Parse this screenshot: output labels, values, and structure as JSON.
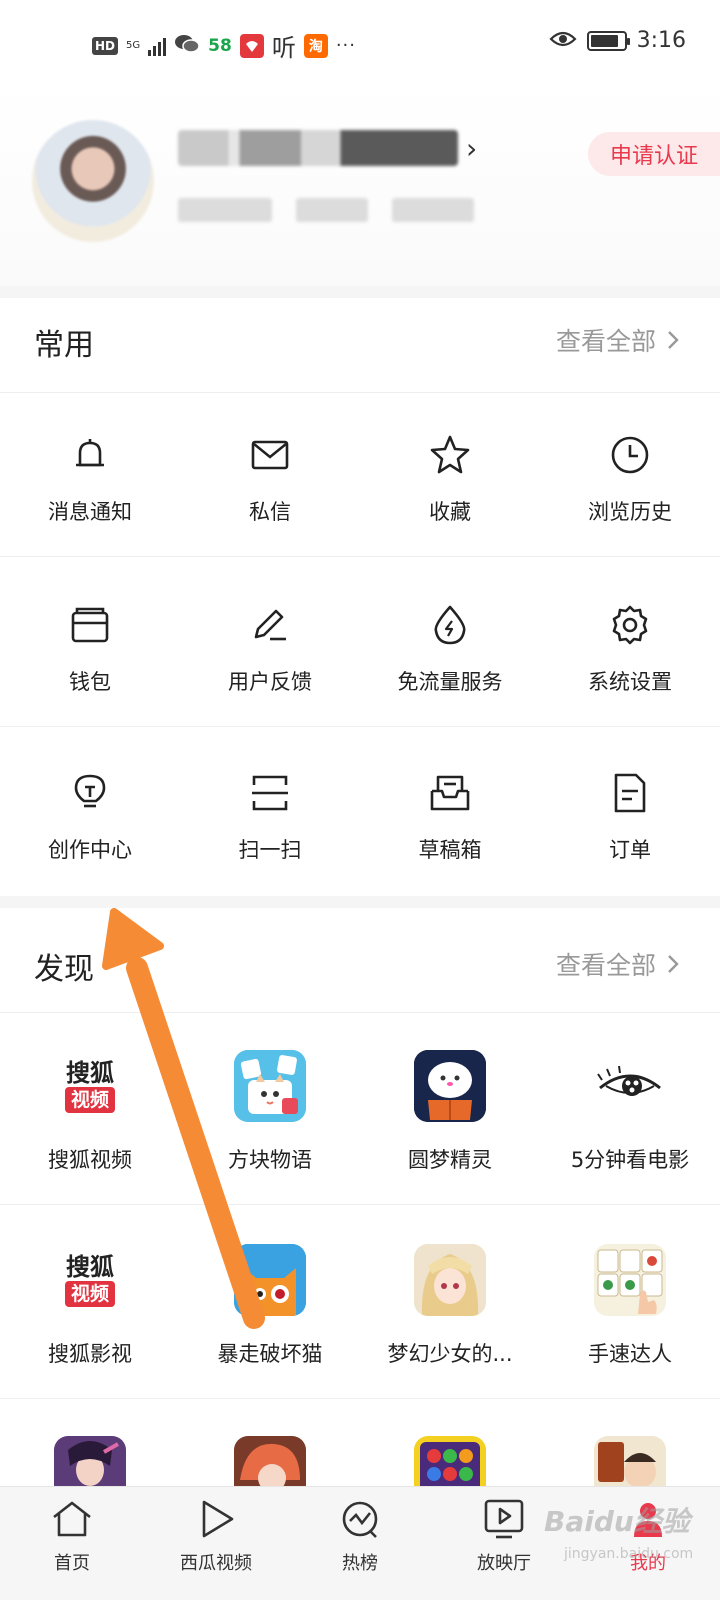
{
  "status_bar": {
    "hd_badge": "HD",
    "network": "5G",
    "app_58": "58",
    "app_ting": "听",
    "app_taobao": "淘",
    "more_dots": "···",
    "time": "3:16",
    "battery_level": 0.85
  },
  "profile": {
    "verify_button": "申请认证"
  },
  "common": {
    "title": "常用",
    "view_all": "查看全部",
    "items": [
      {
        "label": "消息通知",
        "icon": "bell-icon"
      },
      {
        "label": "私信",
        "icon": "mail-icon"
      },
      {
        "label": "收藏",
        "icon": "star-icon"
      },
      {
        "label": "浏览历史",
        "icon": "clock-icon"
      },
      {
        "label": "钱包",
        "icon": "wallet-icon"
      },
      {
        "label": "用户反馈",
        "icon": "pen-icon"
      },
      {
        "label": "免流量服务",
        "icon": "drop-icon"
      },
      {
        "label": "系统设置",
        "icon": "gear-icon"
      },
      {
        "label": "创作中心",
        "icon": "bulb-icon"
      },
      {
        "label": "扫一扫",
        "icon": "scan-icon"
      },
      {
        "label": "草稿箱",
        "icon": "draft-box-icon"
      },
      {
        "label": "订单",
        "icon": "order-icon"
      }
    ]
  },
  "discover": {
    "title": "发现",
    "view_all": "查看全部",
    "sohu_logo_top": "搜狐",
    "sohu_logo_bottom": "视频",
    "items": [
      {
        "label": "搜狐视频"
      },
      {
        "label": "方块物语"
      },
      {
        "label": "圆梦精灵"
      },
      {
        "label": "5分钟看电影"
      },
      {
        "label": "搜狐影视"
      },
      {
        "label": "暴走破坏猫"
      },
      {
        "label": "梦幻少女的..."
      },
      {
        "label": "手速达人"
      }
    ]
  },
  "bottom_nav": {
    "items": [
      {
        "label": "首页"
      },
      {
        "label": "西瓜视频"
      },
      {
        "label": "热榜"
      },
      {
        "label": "放映厅"
      },
      {
        "label": "我的"
      }
    ],
    "accent_color": "#e8394d"
  },
  "watermark": {
    "line1": "Baidu经验",
    "line2": "jingyan.baidu.com"
  }
}
